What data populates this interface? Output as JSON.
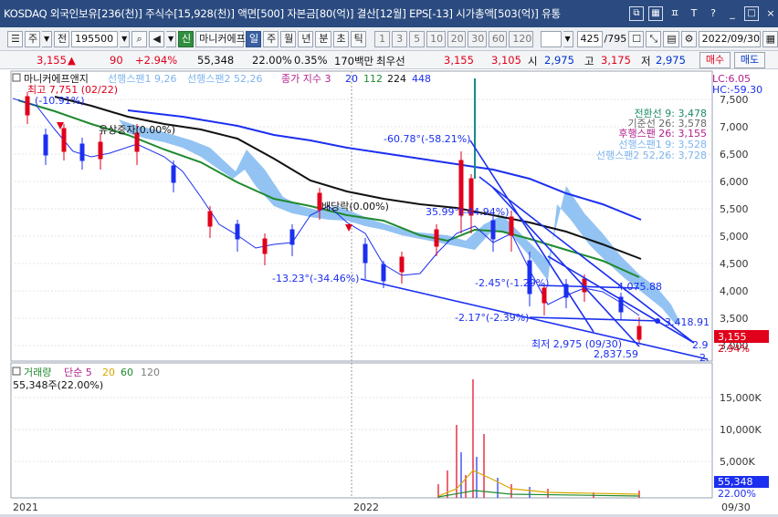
{
  "titlebar": {
    "text": "KOSDAQ 외국인보유[236(천)] 주식수[15,928(천)] 액면[500] 자본금[80(억)] 결산[12월] EPS[-13] 시가총액[503(억)] 유통"
  },
  "toolbar": {
    "code": "195500",
    "items": [
      "신",
      "마니커에프",
      "일",
      "주",
      "월",
      "년",
      "분",
      "초",
      "틱"
    ],
    "periods": [
      "1",
      "3",
      "5",
      "10",
      "20",
      "30",
      "60",
      "120"
    ],
    "counter": "425",
    "counter_total": "/795",
    "date": "2022/09/30",
    "kind": "주",
    "jeon": "전"
  },
  "quote": {
    "price": "3,155",
    "arrow": "▲",
    "change": "90",
    "change_pct": "+2.94%",
    "volume": "55,348",
    "vol_ratio": "22.00%",
    "turnover": "0.35%",
    "amount": "170백만",
    "pref_label": "최우선",
    "ask": "3,155",
    "bid": "3,105",
    "open_label": "시",
    "open": "2,975",
    "high_label": "고",
    "high": "3,175",
    "low_label": "저",
    "low": "2,975",
    "buy_label": "매수",
    "sell_label": "매도"
  },
  "chart": {
    "legend": {
      "name": "마니커에프앤지",
      "span1": "선행스팬1 9,26",
      "span2": "선행스팬2 52,26",
      "close": "종가 지수 3",
      "ma20": "20",
      "ma112": "112",
      "ma224": "224",
      "ma448": "448"
    },
    "corner": {
      "lc": "LC:6.05",
      "hc": "HC:-59.30"
    },
    "ichimoku": {
      "conv": "전환선 9: 3,478",
      "base": "기준선 26: 3,578",
      "lag": "후행스팬 26: 3,155",
      "span1": "선행스팬1 9: 3,528",
      "span2": "선행스팬2 52,26: 3,728"
    },
    "annotations": {
      "high": "최고 7,751 (02/22)",
      "trend1": "(-10.91%)",
      "marker1": "유상증자(0.00%)",
      "marker2": "배당락(0.00%)",
      "angle1": "-60.78°(-58.21%)",
      "angle2": "35.99°(-44.94%)",
      "angle3": "-13.23°(-34.46%)",
      "angle4": "-2.45°(-1.29%)",
      "angle5": "-2.17°(-2.39%)",
      "level1": "4,075.88",
      "level2": "3,418.91",
      "low": "최저 2,975 (09/30)",
      "level3": "2,837.59",
      "edge1": "2.9",
      "edge2": "2."
    },
    "price_axis": [
      "7,500",
      "7,000",
      "6,500",
      "6,000",
      "5,500",
      "5,000",
      "4,500",
      "4,000",
      "3,500",
      "3,000"
    ],
    "price_label": "3,155",
    "price_label_pct": "2.94%",
    "volume_legend": {
      "name": "거래량",
      "ma": "단순 5",
      "ma20": "20",
      "ma60": "60",
      "ma120": "120",
      "value": "55,348주(22.00%)"
    },
    "volume_axis": [
      "15,000K",
      "10,000K",
      "5,000K"
    ],
    "volume_label": "55,348",
    "volume_label_pct": "22.00%",
    "x_axis": [
      "2021",
      "2022"
    ],
    "x_axis_end": "09/30"
  }
}
